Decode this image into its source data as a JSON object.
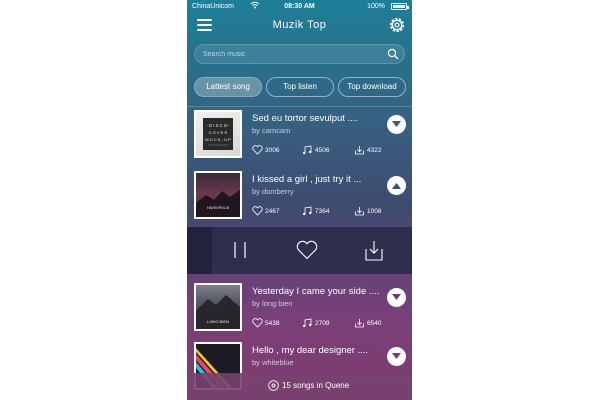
{
  "status_bar": {
    "carrier": "ChinaUnicom",
    "time": "08:30 AM",
    "battery_percent": "100%",
    "battery_level": 1.0
  },
  "header": {
    "title": "Muzik  Top"
  },
  "search": {
    "placeholder": "Search music"
  },
  "tabs": [
    {
      "label": "Lattest song",
      "active": true
    },
    {
      "label": "Top listen",
      "active": false
    },
    {
      "label": "Top download",
      "active": false
    }
  ],
  "songs": [
    {
      "title": "Sed eu tortor sevulput ....",
      "artist": "by camcam",
      "likes": "3006",
      "plays": "4506",
      "downloads": "4322",
      "expanded": false
    },
    {
      "title": "I kissed a girl , just try it ...",
      "artist": "by domberry",
      "likes": "2467",
      "plays": "7364",
      "downloads": "1008",
      "expanded": true
    },
    {
      "title": "Yesterday I came your side ....",
      "artist": "by long bien",
      "likes": "5438",
      "plays": "2709",
      "downloads": "6540",
      "expanded": false
    },
    {
      "title": "Hello , my dear designer ....",
      "artist": "by whiteblue",
      "expanded": false
    }
  ],
  "covers": [
    {
      "text": "-DISCO- COVER MOCK-UP"
    },
    {
      "text": "HAVENPOLIS"
    },
    {
      "text": "LONG BIEN"
    }
  ],
  "queue": {
    "text": "15 songs in Quene"
  },
  "colors": {
    "accent": "#1e7f98",
    "text": "#ffffff",
    "player_bar": "#2a2c46"
  }
}
